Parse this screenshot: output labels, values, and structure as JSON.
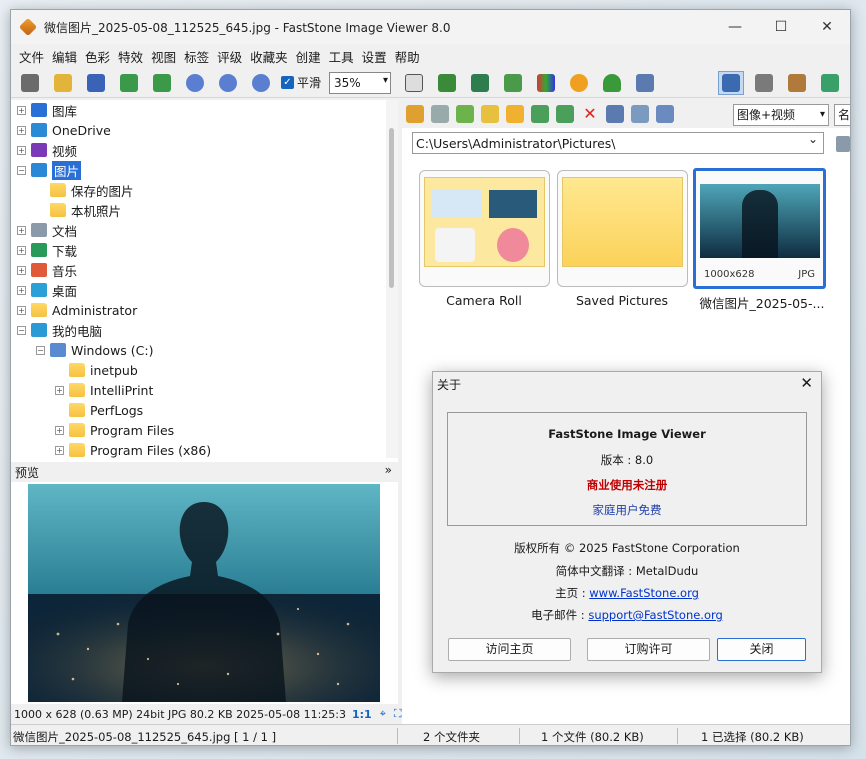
{
  "window": {
    "title": "微信图片_2025-05-08_112525_645.jpg  -  FastStone Image Viewer 8.0",
    "minimize": "—",
    "maximize": "☐",
    "close": "✕"
  },
  "menu": [
    "文件",
    "编辑",
    "色彩",
    "特效",
    "视图",
    "标签",
    "评级",
    "收藏夹",
    "创建",
    "工具",
    "设置",
    "帮助"
  ],
  "toolbar": {
    "smooth_label": "平滑",
    "smooth_checked": true,
    "zoom_value": "35%"
  },
  "tree": {
    "items": [
      {
        "label": "图库",
        "level": 0,
        "exp": "+",
        "icon": "gallery-icon"
      },
      {
        "label": "OneDrive",
        "level": 0,
        "exp": "+",
        "icon": "cloud-icon"
      },
      {
        "label": "视频",
        "level": 0,
        "exp": "+",
        "icon": "video-icon"
      },
      {
        "label": "图片",
        "level": 0,
        "exp": "−",
        "icon": "pictures-icon",
        "selected": true
      },
      {
        "label": "保存的图片",
        "level": 1,
        "exp": "",
        "icon": "folder-icon"
      },
      {
        "label": "本机照片",
        "level": 1,
        "exp": "",
        "icon": "folder-icon"
      },
      {
        "label": "文档",
        "level": 0,
        "exp": "+",
        "icon": "document-icon"
      },
      {
        "label": "下载",
        "level": 0,
        "exp": "+",
        "icon": "download-icon"
      },
      {
        "label": "音乐",
        "level": 0,
        "exp": "+",
        "icon": "music-icon"
      },
      {
        "label": "桌面",
        "level": 0,
        "exp": "+",
        "icon": "desktop-icon"
      },
      {
        "label": "Administrator",
        "level": 0,
        "exp": "+",
        "icon": "folder-icon"
      },
      {
        "label": "我的电脑",
        "level": 0,
        "exp": "−",
        "icon": "computer-icon"
      },
      {
        "label": "Windows (C:)",
        "level": 1,
        "exp": "−",
        "icon": "drive-icon"
      },
      {
        "label": "inetpub",
        "level": 2,
        "exp": "",
        "icon": "folder-icon"
      },
      {
        "label": "IntelliPrint",
        "level": 2,
        "exp": "+",
        "icon": "folder-icon"
      },
      {
        "label": "PerfLogs",
        "level": 2,
        "exp": "",
        "icon": "folder-icon"
      },
      {
        "label": "Program Files",
        "level": 2,
        "exp": "+",
        "icon": "folder-icon"
      },
      {
        "label": "Program Files (x86)",
        "level": 2,
        "exp": "+",
        "icon": "folder-icon"
      }
    ]
  },
  "preview": {
    "header": "预览",
    "collapse": "»",
    "status": "1000 x 628 (0.63 MP)  24bit  JPG  80.2 KB  2025-05-08 11:25:3",
    "ratio": "1:1"
  },
  "browser": {
    "view_mode": "图像+视频",
    "sort_label": "名",
    "path": "C:\\Users\\Administrator\\Pictures\\",
    "thumbs": [
      {
        "label": "Camera Roll",
        "kind": "folder"
      },
      {
        "label": "Saved Pictures",
        "kind": "folder"
      },
      {
        "label": "微信图片_2025-05-...",
        "kind": "image",
        "dims": "1000x628",
        "ext": "JPG"
      }
    ]
  },
  "about": {
    "title": "关于",
    "product": "FastStone Image Viewer",
    "version": "版本 : 8.0",
    "license_status": "商业使用未注册",
    "home_free": "家庭用户免费",
    "copyright": "版权所有 © 2025 FastStone Corporation",
    "translation": "简体中文翻译 : MetalDudu",
    "homepage_label": "主页 :",
    "homepage_url": "www.FastStone.org",
    "email_label": "电子邮件 :",
    "email": "support@FastStone.org",
    "btn_home": "访问主页",
    "btn_buy": "订购许可",
    "btn_close": "关闭",
    "colors": {
      "red": "#c00000",
      "blue": "#1a3aa8"
    }
  },
  "status": {
    "file": "微信图片_2025-05-08_112525_645.jpg [ 1 / 1 ]",
    "folders": "2 个文件夹",
    "files": "1 个文件 (80.2 KB)",
    "selected": "1 已选择 (80.2 KB)"
  }
}
